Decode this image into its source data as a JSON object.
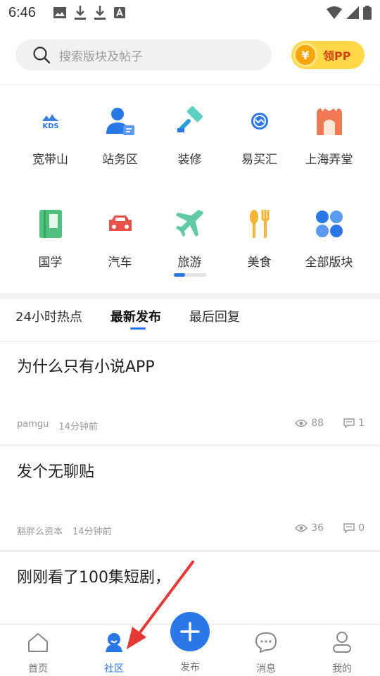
{
  "status_bar": {
    "time": "6:46"
  },
  "header": {
    "search_placeholder": "搜索版块及帖子",
    "coin_symbol": "¥",
    "coin_label": "领PP"
  },
  "categories": [
    {
      "label": "宽带山",
      "icon": "kds-logo-icon",
      "icon_text": "KDS"
    },
    {
      "label": "站务区",
      "icon": "staff-user-icon"
    },
    {
      "label": "装修",
      "icon": "paint-roller-icon"
    },
    {
      "label": "易买汇",
      "icon": "exchange-icon"
    },
    {
      "label": "上海弄堂",
      "icon": "gate-building-icon"
    },
    {
      "label": "国学",
      "icon": "book-icon"
    },
    {
      "label": "汽车",
      "icon": "car-icon"
    },
    {
      "label": "旅游",
      "icon": "airplane-icon"
    },
    {
      "label": "美食",
      "icon": "spoon-fork-icon"
    },
    {
      "label": "全部版块",
      "icon": "grid-clover-icon"
    }
  ],
  "tabs": [
    {
      "label": "24小时热点"
    },
    {
      "label": "最新发布",
      "active": true
    },
    {
      "label": "最后回复"
    }
  ],
  "posts": [
    {
      "title": "为什么只有小说APP",
      "author": "pamgu",
      "time": "14分钟前",
      "views": "88",
      "comments": "1"
    },
    {
      "title": "发个无聊贴",
      "author": "豁胖么资本",
      "time": "14分钟前",
      "views": "36",
      "comments": "0"
    },
    {
      "title": "刚刚看了100集短剧，"
    }
  ],
  "bottom_nav": [
    {
      "label": "首页"
    },
    {
      "label": "社区",
      "active": true
    },
    {
      "label": "发布"
    },
    {
      "label": "消息"
    },
    {
      "label": "我的"
    }
  ],
  "colors": {
    "accent": "#2a78e8",
    "arrow": "#e53935",
    "coin": "#ffd84a"
  }
}
